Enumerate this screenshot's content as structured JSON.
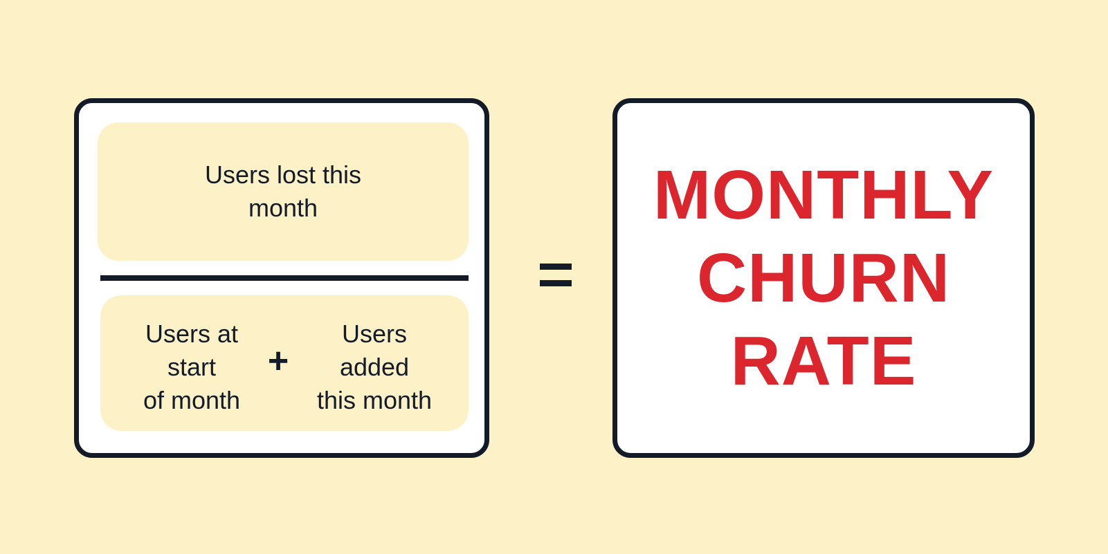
{
  "numerator": {
    "label": "Users lost this month"
  },
  "denominator": {
    "left_term": "Users at\nstart\nof month",
    "operator": "+",
    "right_term": "Users\nadded\nthis month"
  },
  "result": {
    "label": "MONTHLY\nCHURN\nRATE"
  },
  "colors": {
    "background": "#fdf2c7",
    "ink": "#141b28",
    "accent": "#dc262d",
    "card": "#ffffff"
  }
}
